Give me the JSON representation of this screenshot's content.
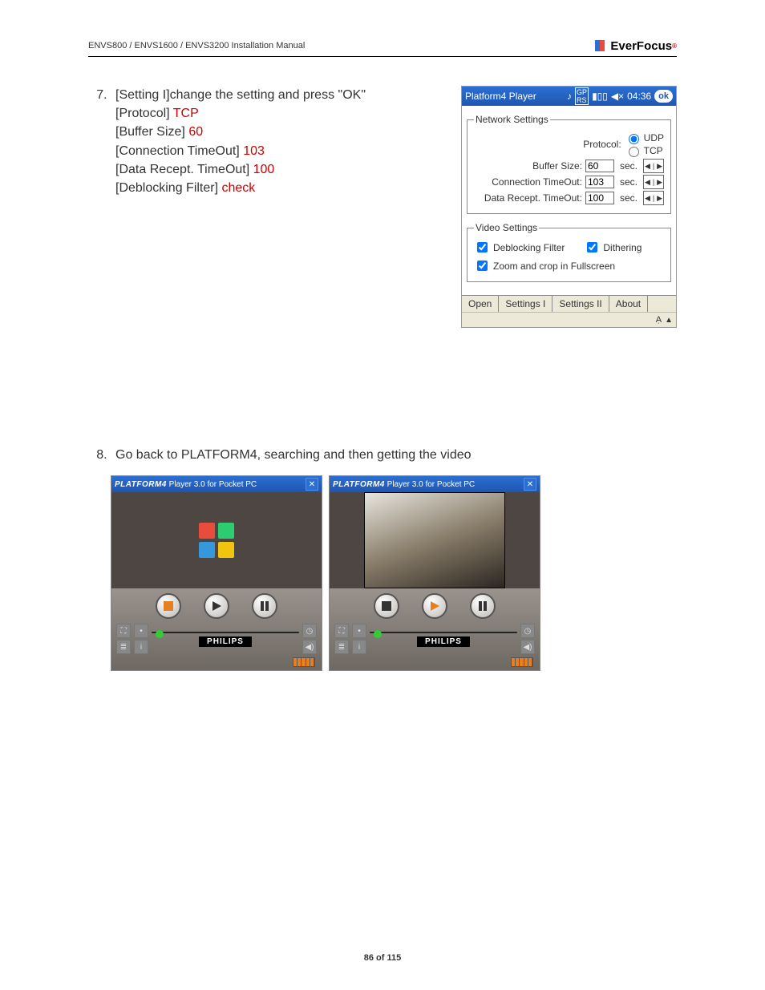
{
  "header": {
    "left": "ENVS800 / ENVS1600 / ENVS3200 Installation Manual",
    "logo_text": "EverFocus"
  },
  "step7": {
    "number": "7.",
    "intro": "[Setting I]change the setting and press \"OK\"",
    "lines": [
      {
        "label": "[Protocol] ",
        "value": "TCP"
      },
      {
        "label": "[Buffer Size] ",
        "value": "60"
      },
      {
        "label": "[Connection TimeOut] ",
        "value": "103"
      },
      {
        "label": "[Data Recept. TimeOut] ",
        "value": "100"
      },
      {
        "label": "[Deblocking Filter] ",
        "value": "check"
      }
    ]
  },
  "pda": {
    "title": "Platform4 Player",
    "time": "04:36",
    "ok": "ok",
    "network": {
      "legend": "Network Settings",
      "protocol_label": "Protocol:",
      "protocol_udp": "UDP",
      "protocol_tcp": "TCP",
      "buffer_label": "Buffer Size:",
      "buffer_value": "60",
      "conn_label": "Connection TimeOut:",
      "conn_value": "103",
      "data_label": "Data Recept. TimeOut:",
      "data_value": "100",
      "unit": "sec."
    },
    "video": {
      "legend": "Video Settings",
      "deblocking": "Deblocking Filter",
      "dithering": "Dithering",
      "zoom": "Zoom and crop in Fullscreen"
    },
    "tabs": {
      "open": "Open",
      "s1": "Settings I",
      "s2": "Settings II",
      "about": "About"
    }
  },
  "step8": {
    "number": "8.",
    "text": "Go back to PLATFORM4, searching and then getting the video"
  },
  "player": {
    "brand": "PLATFORM4",
    "title_rest": " Player 3.0 for Pocket PC",
    "footer_brand": "PHILIPS"
  },
  "footer": "86 of 115"
}
